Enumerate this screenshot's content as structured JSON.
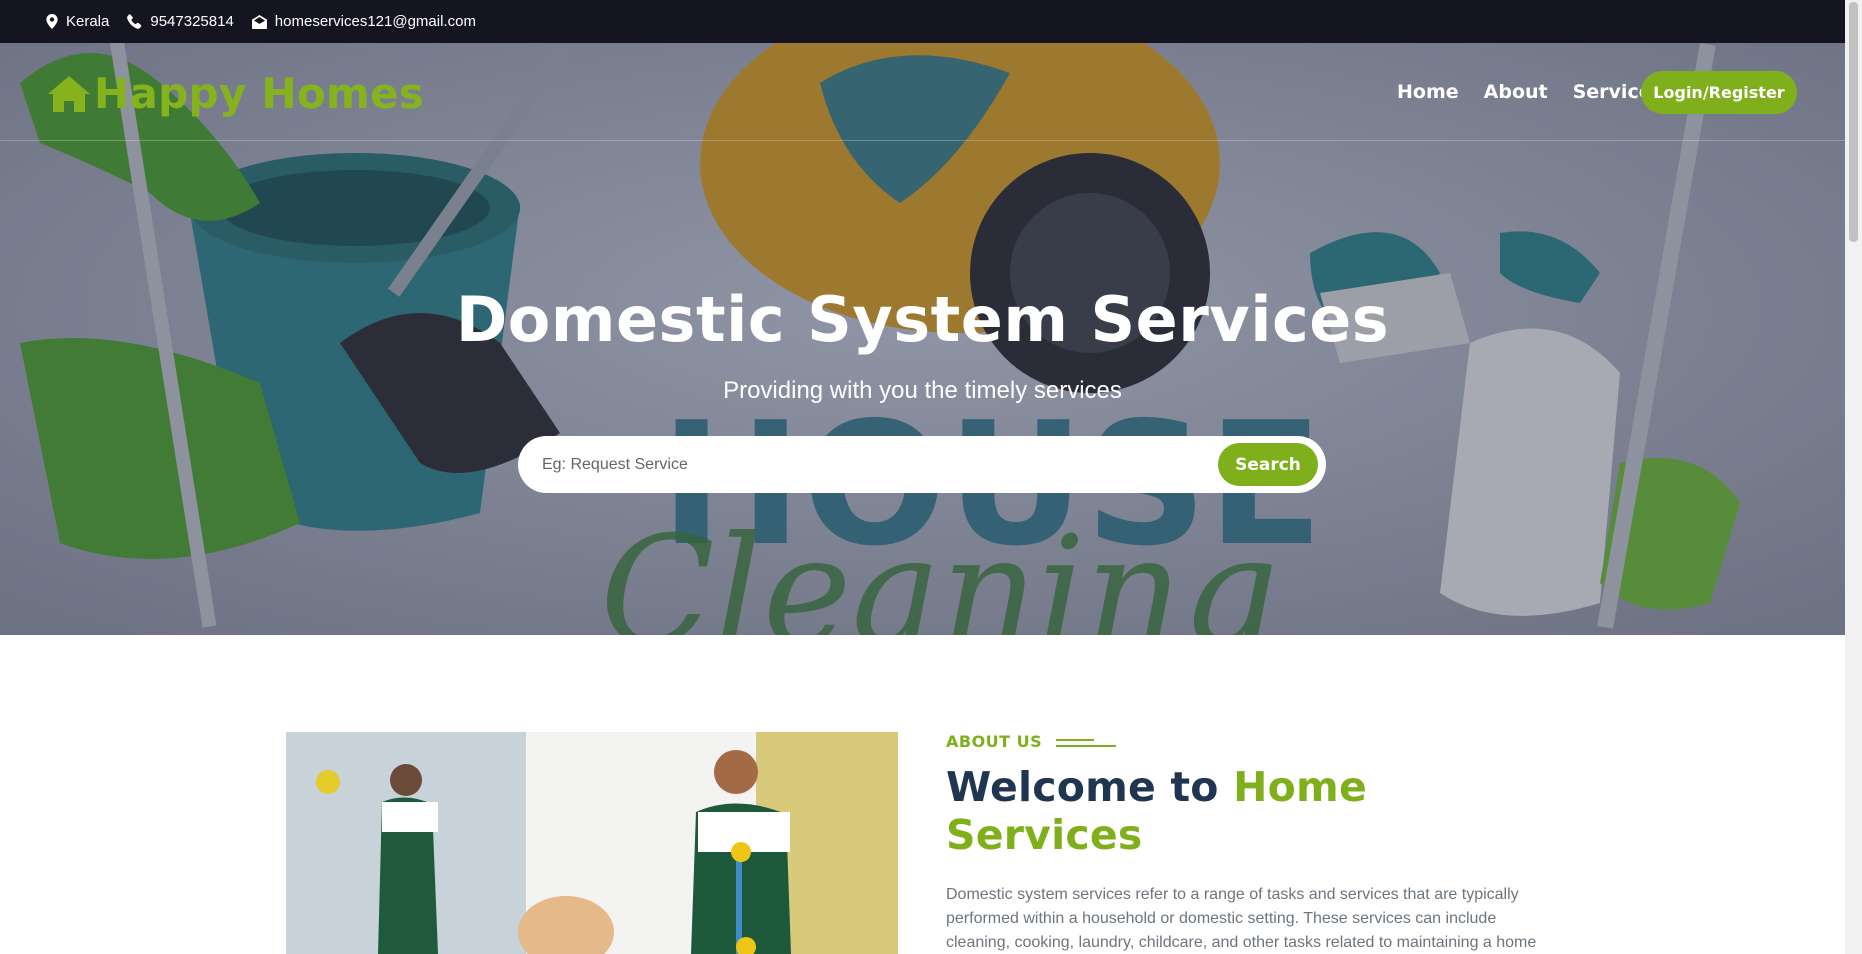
{
  "topbar": {
    "location": "Kerala",
    "phone": "9547325814",
    "email": "homeservices121@gmail.com"
  },
  "brand": {
    "name": "Happy Homes",
    "icon": "house-icon"
  },
  "nav": {
    "links": [
      "Home",
      "About",
      "Services"
    ],
    "login_label": "Login/Register"
  },
  "hero": {
    "title": "Domestic System Services",
    "subtitle": "Providing with you the timely services",
    "search_placeholder": "Eg: Request Service",
    "search_button": "Search",
    "background_text": [
      "HOUSE",
      "Cleaning"
    ]
  },
  "about": {
    "label": "ABOUT US",
    "heading_main": "Welcome to ",
    "heading_accent": "Home Services",
    "paragraph": "Domestic system services refer to a range of tasks and services that are typically performed within a household or domestic setting. These services can include cleaning, cooking, laundry, childcare, and other tasks related to maintaining a home and supporting the well-being of those who live within it."
  },
  "colors": {
    "accent": "#7fb01b",
    "topbar_bg": "#151522",
    "heading": "#1f3550",
    "body_text": "#6c757d"
  }
}
